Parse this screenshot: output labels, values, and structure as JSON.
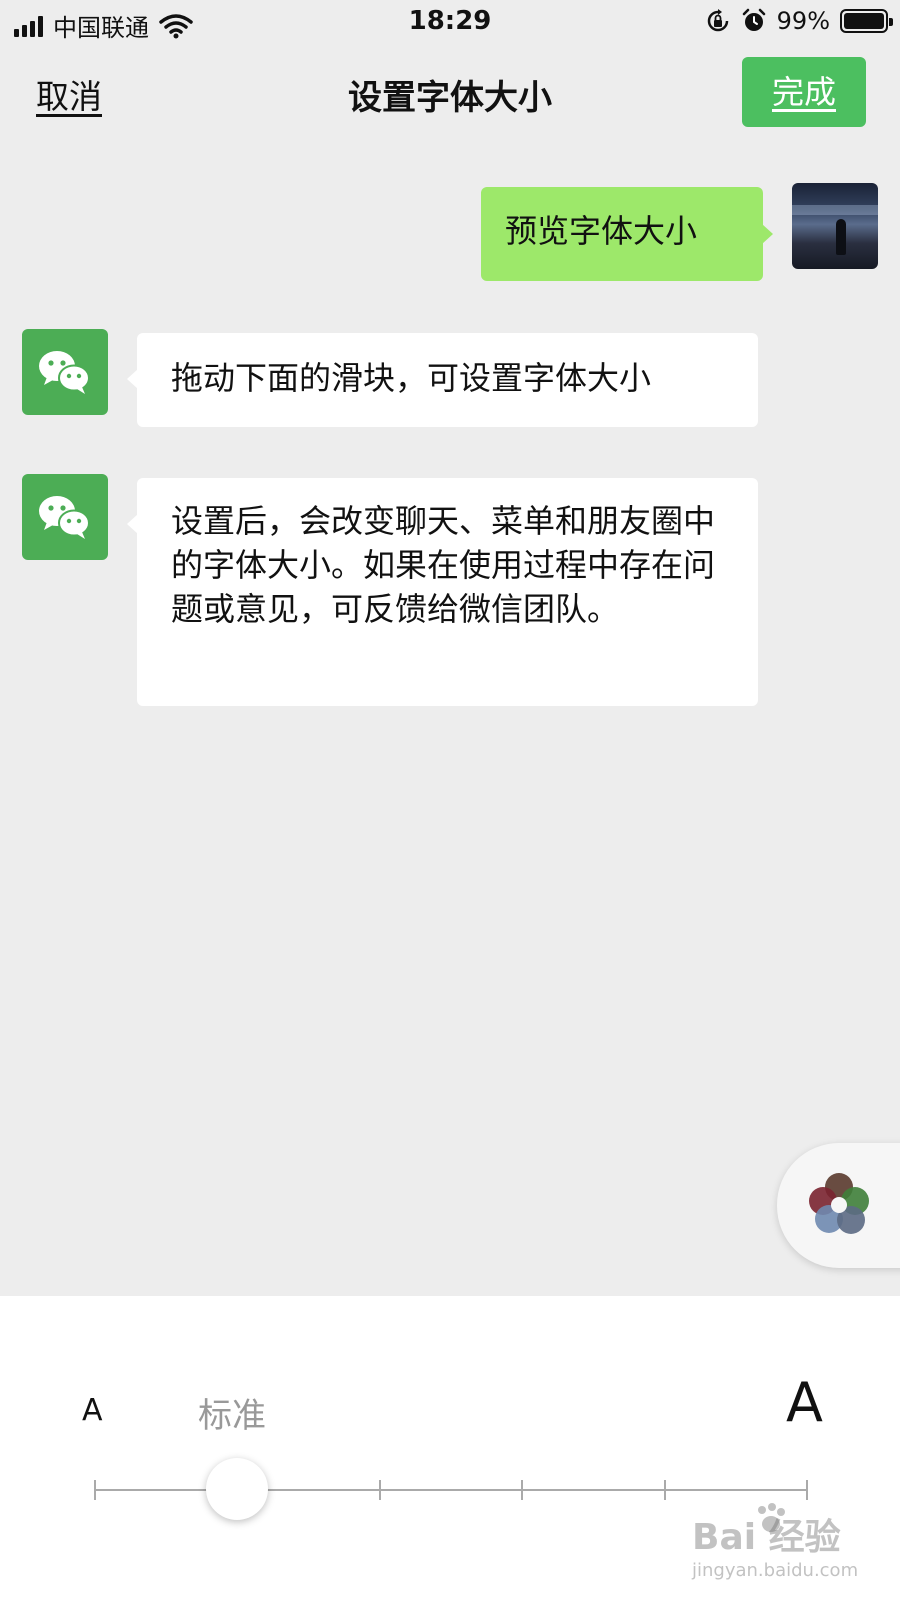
{
  "status_bar": {
    "carrier": "中国联通",
    "time": "18:29",
    "battery_percent": "99%",
    "battery_level": 0.99,
    "icons": [
      "signal-icon",
      "wifi-icon",
      "orientation-lock-icon",
      "alarm-icon",
      "battery-icon"
    ]
  },
  "nav": {
    "cancel_label": "取消",
    "title": "设置字体大小",
    "done_label": "完成",
    "accent_color": "#4cbf60"
  },
  "chat": {
    "messages": [
      {
        "sender": "user",
        "text": "预览字体大小",
        "bubble_color": "#9de86a"
      },
      {
        "sender": "wechat",
        "text": "拖动下面的滑块，可设置字体大小",
        "bubble_color": "#ffffff"
      },
      {
        "sender": "wechat",
        "text": "设置后，会改变聊天、菜单和朋友圈中的字体大小。如果在使用过程中存在问题或意见，可反馈给微信团队。",
        "bubble_color": "#ffffff"
      }
    ]
  },
  "font_slider": {
    "small_label": "A",
    "large_label": "A",
    "current_label": "标准",
    "steps": 6,
    "selected_index": 1
  },
  "watermark": {
    "main": "Bai 经验",
    "sub": "jingyan.baidu.com"
  }
}
